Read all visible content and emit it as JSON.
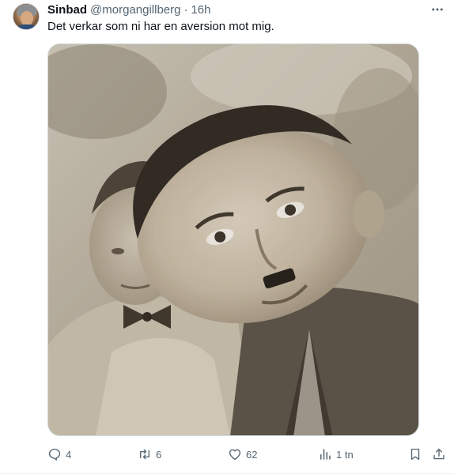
{
  "tweet": {
    "author_name": "Sinbad",
    "author_handle": "@morgangillberg",
    "separator": "·",
    "time": "16h",
    "text": "Det verkar som ni har en aversion mot mig.",
    "media": {
      "type": "photo",
      "tone": "sepia"
    }
  },
  "icons": {
    "more": "more-horizontal-icon",
    "reply": "reply-icon",
    "retweet": "retweet-icon",
    "like": "heart-icon",
    "views": "views-chart-icon",
    "bookmark": "bookmark-icon",
    "share": "share-icon"
  },
  "actions": {
    "replies": "4",
    "retweets": "6",
    "likes": "62",
    "views": "1 tn"
  },
  "colors": {
    "text_primary": "#0f1419",
    "text_secondary": "#536471",
    "border": "#cfd9de"
  }
}
